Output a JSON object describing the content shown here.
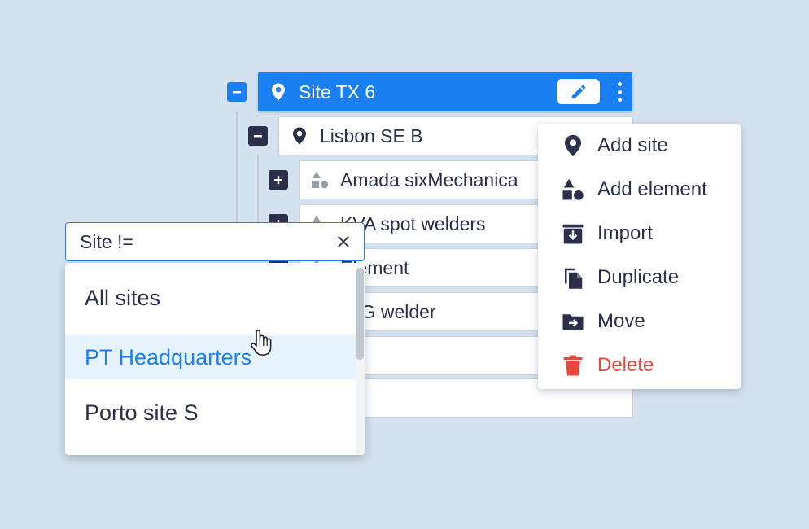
{
  "tree": {
    "root": {
      "label": "Site TX 6",
      "toggle": "collapse",
      "icon": "map-pin-icon"
    },
    "child": {
      "label": "Lisbon SE B",
      "toggle": "collapse",
      "icon": "map-pin-icon"
    },
    "items": [
      {
        "label": "Amada sixMechanica",
        "toggle": "expand",
        "icon": "shapes-icon"
      },
      {
        "label": "KVA spot welders",
        "toggle": "expand",
        "icon": "shapes-icon"
      },
      {
        "label": "Element",
        "icon": "shapes-icon"
      },
      {
        "label": "MIG welder",
        "icon": "shapes-icon"
      },
      {
        "label": ""
      },
      {
        "label": ""
      }
    ]
  },
  "context_menu": {
    "items": [
      {
        "label": "Add site",
        "icon": "map-pin-icon"
      },
      {
        "label": "Add element",
        "icon": "shapes-icon"
      },
      {
        "label": "Import",
        "icon": "import-icon"
      },
      {
        "label": "Duplicate",
        "icon": "duplicate-icon"
      },
      {
        "label": "Move",
        "icon": "move-folder-icon"
      },
      {
        "label": "Delete",
        "icon": "trash-icon",
        "color": "#e8453c"
      }
    ]
  },
  "filter": {
    "value": "Site !=",
    "options": [
      "All sites",
      "PT Headquarters",
      "Porto site S"
    ],
    "hovered": "PT Headquarters"
  },
  "colors": {
    "accent": "#1a7ff0",
    "dark": "#2b2f4a",
    "danger": "#e8453c",
    "background": "#d4e1ee",
    "hover_bg": "#e6f2fc"
  }
}
